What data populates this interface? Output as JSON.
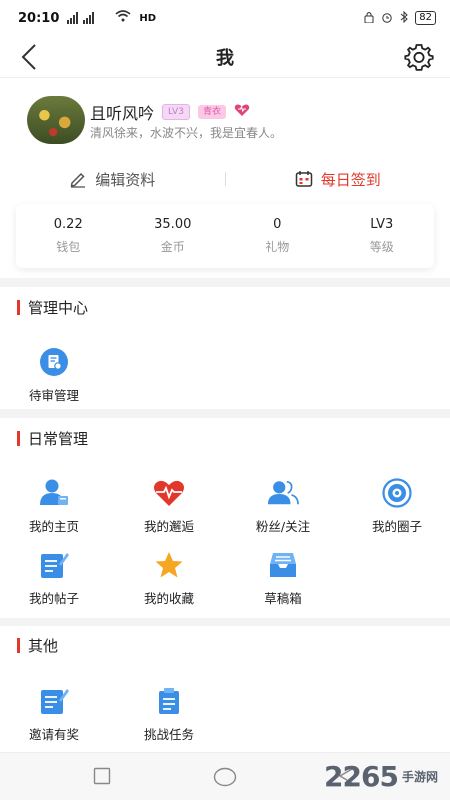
{
  "status_bar": {
    "time": "20:10",
    "signal": "4G 4G",
    "network": "HD",
    "battery": "82"
  },
  "nav": {
    "title": "我"
  },
  "profile": {
    "username": "且听风吟",
    "level_badge": "LV3",
    "title_badge": "青衣",
    "signature": "清风徐来，水波不兴，我是宜春人。",
    "edit_label": "编辑资料",
    "checkin_label": "每日签到"
  },
  "stats": [
    {
      "value": "0.22",
      "label": "钱包"
    },
    {
      "value": "35.00",
      "label": "金币"
    },
    {
      "value": "0",
      "label": "礼物"
    },
    {
      "value": "LV3",
      "label": "等级"
    }
  ],
  "sections": {
    "manage": {
      "title": "管理中心",
      "items": [
        {
          "label": "待审管理",
          "icon": "review-icon"
        }
      ]
    },
    "daily": {
      "title": "日常管理",
      "items": [
        {
          "label": "我的主页",
          "icon": "homepage-icon"
        },
        {
          "label": "我的邂逅",
          "icon": "heartbeat-icon"
        },
        {
          "label": "粉丝/关注",
          "icon": "followers-icon"
        },
        {
          "label": "我的圈子",
          "icon": "circle-icon"
        },
        {
          "label": "我的帖子",
          "icon": "post-icon"
        },
        {
          "label": "我的收藏",
          "icon": "star-icon"
        },
        {
          "label": "草稿箱",
          "icon": "drafts-icon"
        }
      ]
    },
    "other": {
      "title": "其他",
      "items": [
        {
          "label": "邀请有奖",
          "icon": "invite-icon"
        },
        {
          "label": "挑战任务",
          "icon": "task-icon"
        }
      ]
    }
  },
  "watermark": {
    "brand": "2265",
    "sub": "手游网"
  },
  "colors": {
    "accent": "#e2382c",
    "icon_blue": "#3a8ee6"
  }
}
